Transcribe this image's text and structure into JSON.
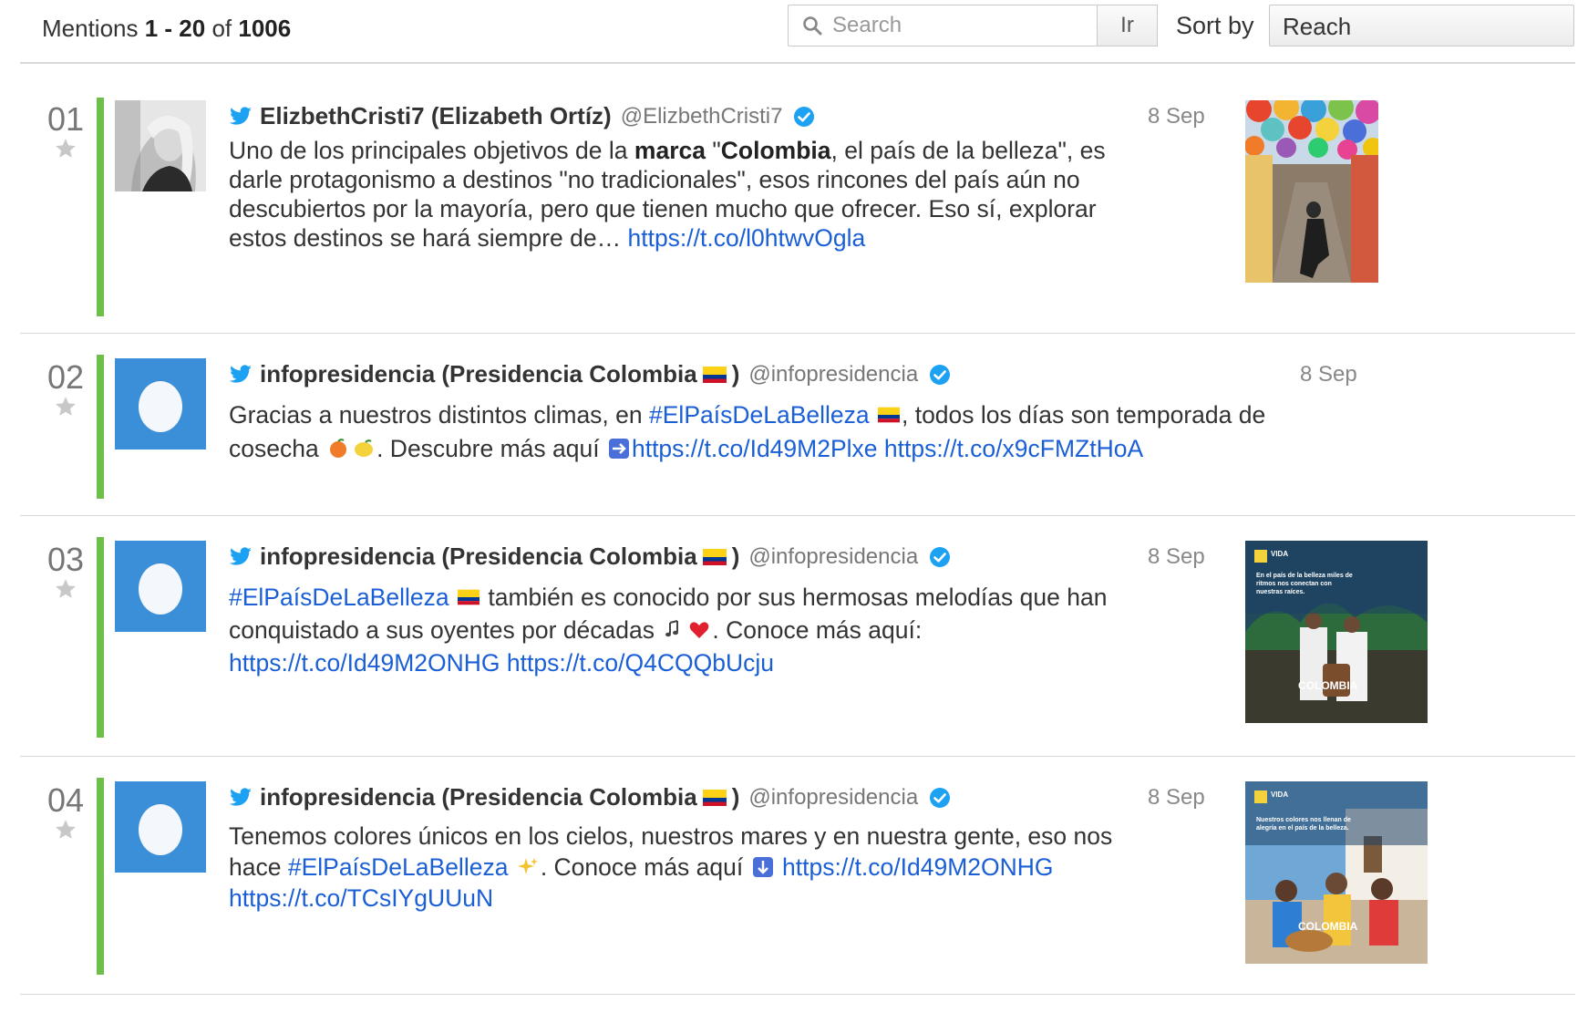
{
  "header": {
    "mentions_prefix": "Mentions",
    "range": "1 - 20",
    "of_label": "of",
    "total": "1006",
    "search_placeholder": "Search",
    "go_label": "Ir",
    "sort_label": "Sort by",
    "sort_value": "Reach"
  },
  "mentions": [
    {
      "rank": "01",
      "author": "ElizbethCristi7 (Elizabeth Ortíz)",
      "handle": "@ElizbethCristi7",
      "date": "8 Sep",
      "text_1": "Uno de los principales objetivos de la",
      "bold_1": "marca",
      "text_2": "\"",
      "bold_2": "Colombia",
      "text_3": ", el país de la belleza\", es darle protagonismo a destinos \"no tradicionales\", esos rincones del país aún no descubiertos por la mayoría, pero que tienen mucho que ofrecer. Eso sí, explorar estos destinos se hará siempre de…",
      "link_1": "https://t.co/l0htwvOgla"
    },
    {
      "rank": "02",
      "author": "infopresidencia (Presidencia Colombia",
      "author_close": ")",
      "handle": "@infopresidencia",
      "date": "8 Sep",
      "text_1": "Gracias a nuestros distintos climas, en",
      "hashtag": "#ElPaísDeLaBelleza",
      "text_2": ", todos los días son temporada de cosecha",
      "text_3": ". Descubre más aquí",
      "link_1": "https://t.co/Id49M2Plxe",
      "link_2": "https://t.co/x9cFMZtHoA"
    },
    {
      "rank": "03",
      "author": "infopresidencia (Presidencia Colombia",
      "author_close": ")",
      "handle": "@infopresidencia",
      "date": "8 Sep",
      "hashtag": "#ElPaísDeLaBelleza",
      "text_1": "también es conocido por sus hermosas melodías que han conquistado a sus oyentes por décadas",
      "text_2": ". Conoce más aquí:",
      "link_1": "https://t.co/Id49M2ONHG",
      "link_2": "https://t.co/Q4CQQbUcju",
      "thumb_brand": "COLOMBIA",
      "thumb_top": "VIDA",
      "thumb_caption": "En el país de la belleza miles de ritmos nos conectan con nuestras raíces."
    },
    {
      "rank": "04",
      "author": "infopresidencia (Presidencia Colombia",
      "author_close": ")",
      "handle": "@infopresidencia",
      "date": "8 Sep",
      "text_1": "Tenemos colores únicos en los cielos, nuestros mares y en nuestra gente, eso nos hace",
      "hashtag": "#ElPaísDeLaBelleza",
      "text_2": ". Conoce más aquí",
      "link_1": "https://t.co/Id49M2ONHG",
      "link_2": "https://t.co/TCsIYgUUuN",
      "thumb_brand": "COLOMBIA",
      "thumb_top": "VIDA",
      "thumb_caption": "Nuestros colores nos llenan de alegría en el país de la belleza."
    }
  ],
  "colors": {
    "accent_bar": "#6cc04a",
    "link": "#1a5fd6",
    "twitter": "#1da1f2",
    "avatar_egg_bg": "#3b8fd9"
  },
  "icons": [
    "search-icon",
    "star-icon",
    "twitter-icon",
    "verified-icon",
    "flag-colombia-icon",
    "egg-avatar-icon"
  ]
}
